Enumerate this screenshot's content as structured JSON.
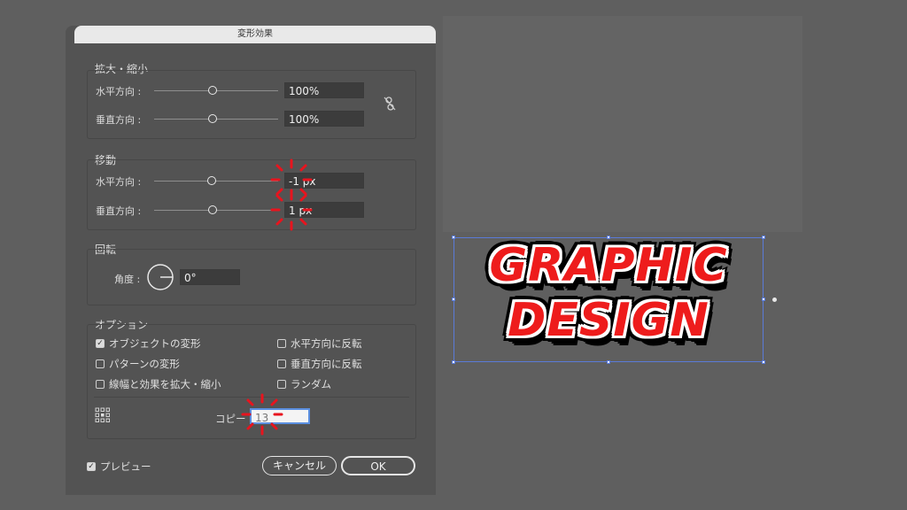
{
  "dialog": {
    "title": "変形効果",
    "scale": {
      "title": "拡大・縮小",
      "horizontal_label": "水平方向 :",
      "horizontal_value": "100%",
      "vertical_label": "垂直方向 :",
      "vertical_value": "100%",
      "link_icon": "unlink-icon"
    },
    "move": {
      "title": "移動",
      "horizontal_label": "水平方向 :",
      "horizontal_value": "-1 px",
      "vertical_label": "垂直方向 :",
      "vertical_value": "1 px"
    },
    "rotate": {
      "title": "回転",
      "angle_label": "角度 :",
      "angle_value": "0°"
    },
    "options": {
      "title": "オプション",
      "transform_objects": {
        "label": "オブジェクトの変形",
        "checked": true
      },
      "transform_patterns": {
        "label": "パターンの変形",
        "checked": false
      },
      "scale_strokes": {
        "label": "線幅と効果を拡大・縮小",
        "checked": false
      },
      "reflect_x": {
        "label": "水平方向に反転",
        "checked": false
      },
      "reflect_y": {
        "label": "垂直方向に反転",
        "checked": false
      },
      "random": {
        "label": "ランダム",
        "checked": false
      },
      "copies_label": "コピー",
      "copies_value": "13"
    },
    "preview": {
      "label": "プレビュー",
      "checked": true
    },
    "cancel_label": "キャンセル",
    "ok_label": "OK"
  },
  "artwork": {
    "line1": "GRAPHIC",
    "line2": "DESIGN",
    "fill_color": "#ee1c1c",
    "stroke_color": "#ffffff",
    "outline_color": "#000000"
  },
  "colors": {
    "background": "#5f5f5f",
    "dialog": "#535353",
    "highlight": "#e8141e"
  }
}
